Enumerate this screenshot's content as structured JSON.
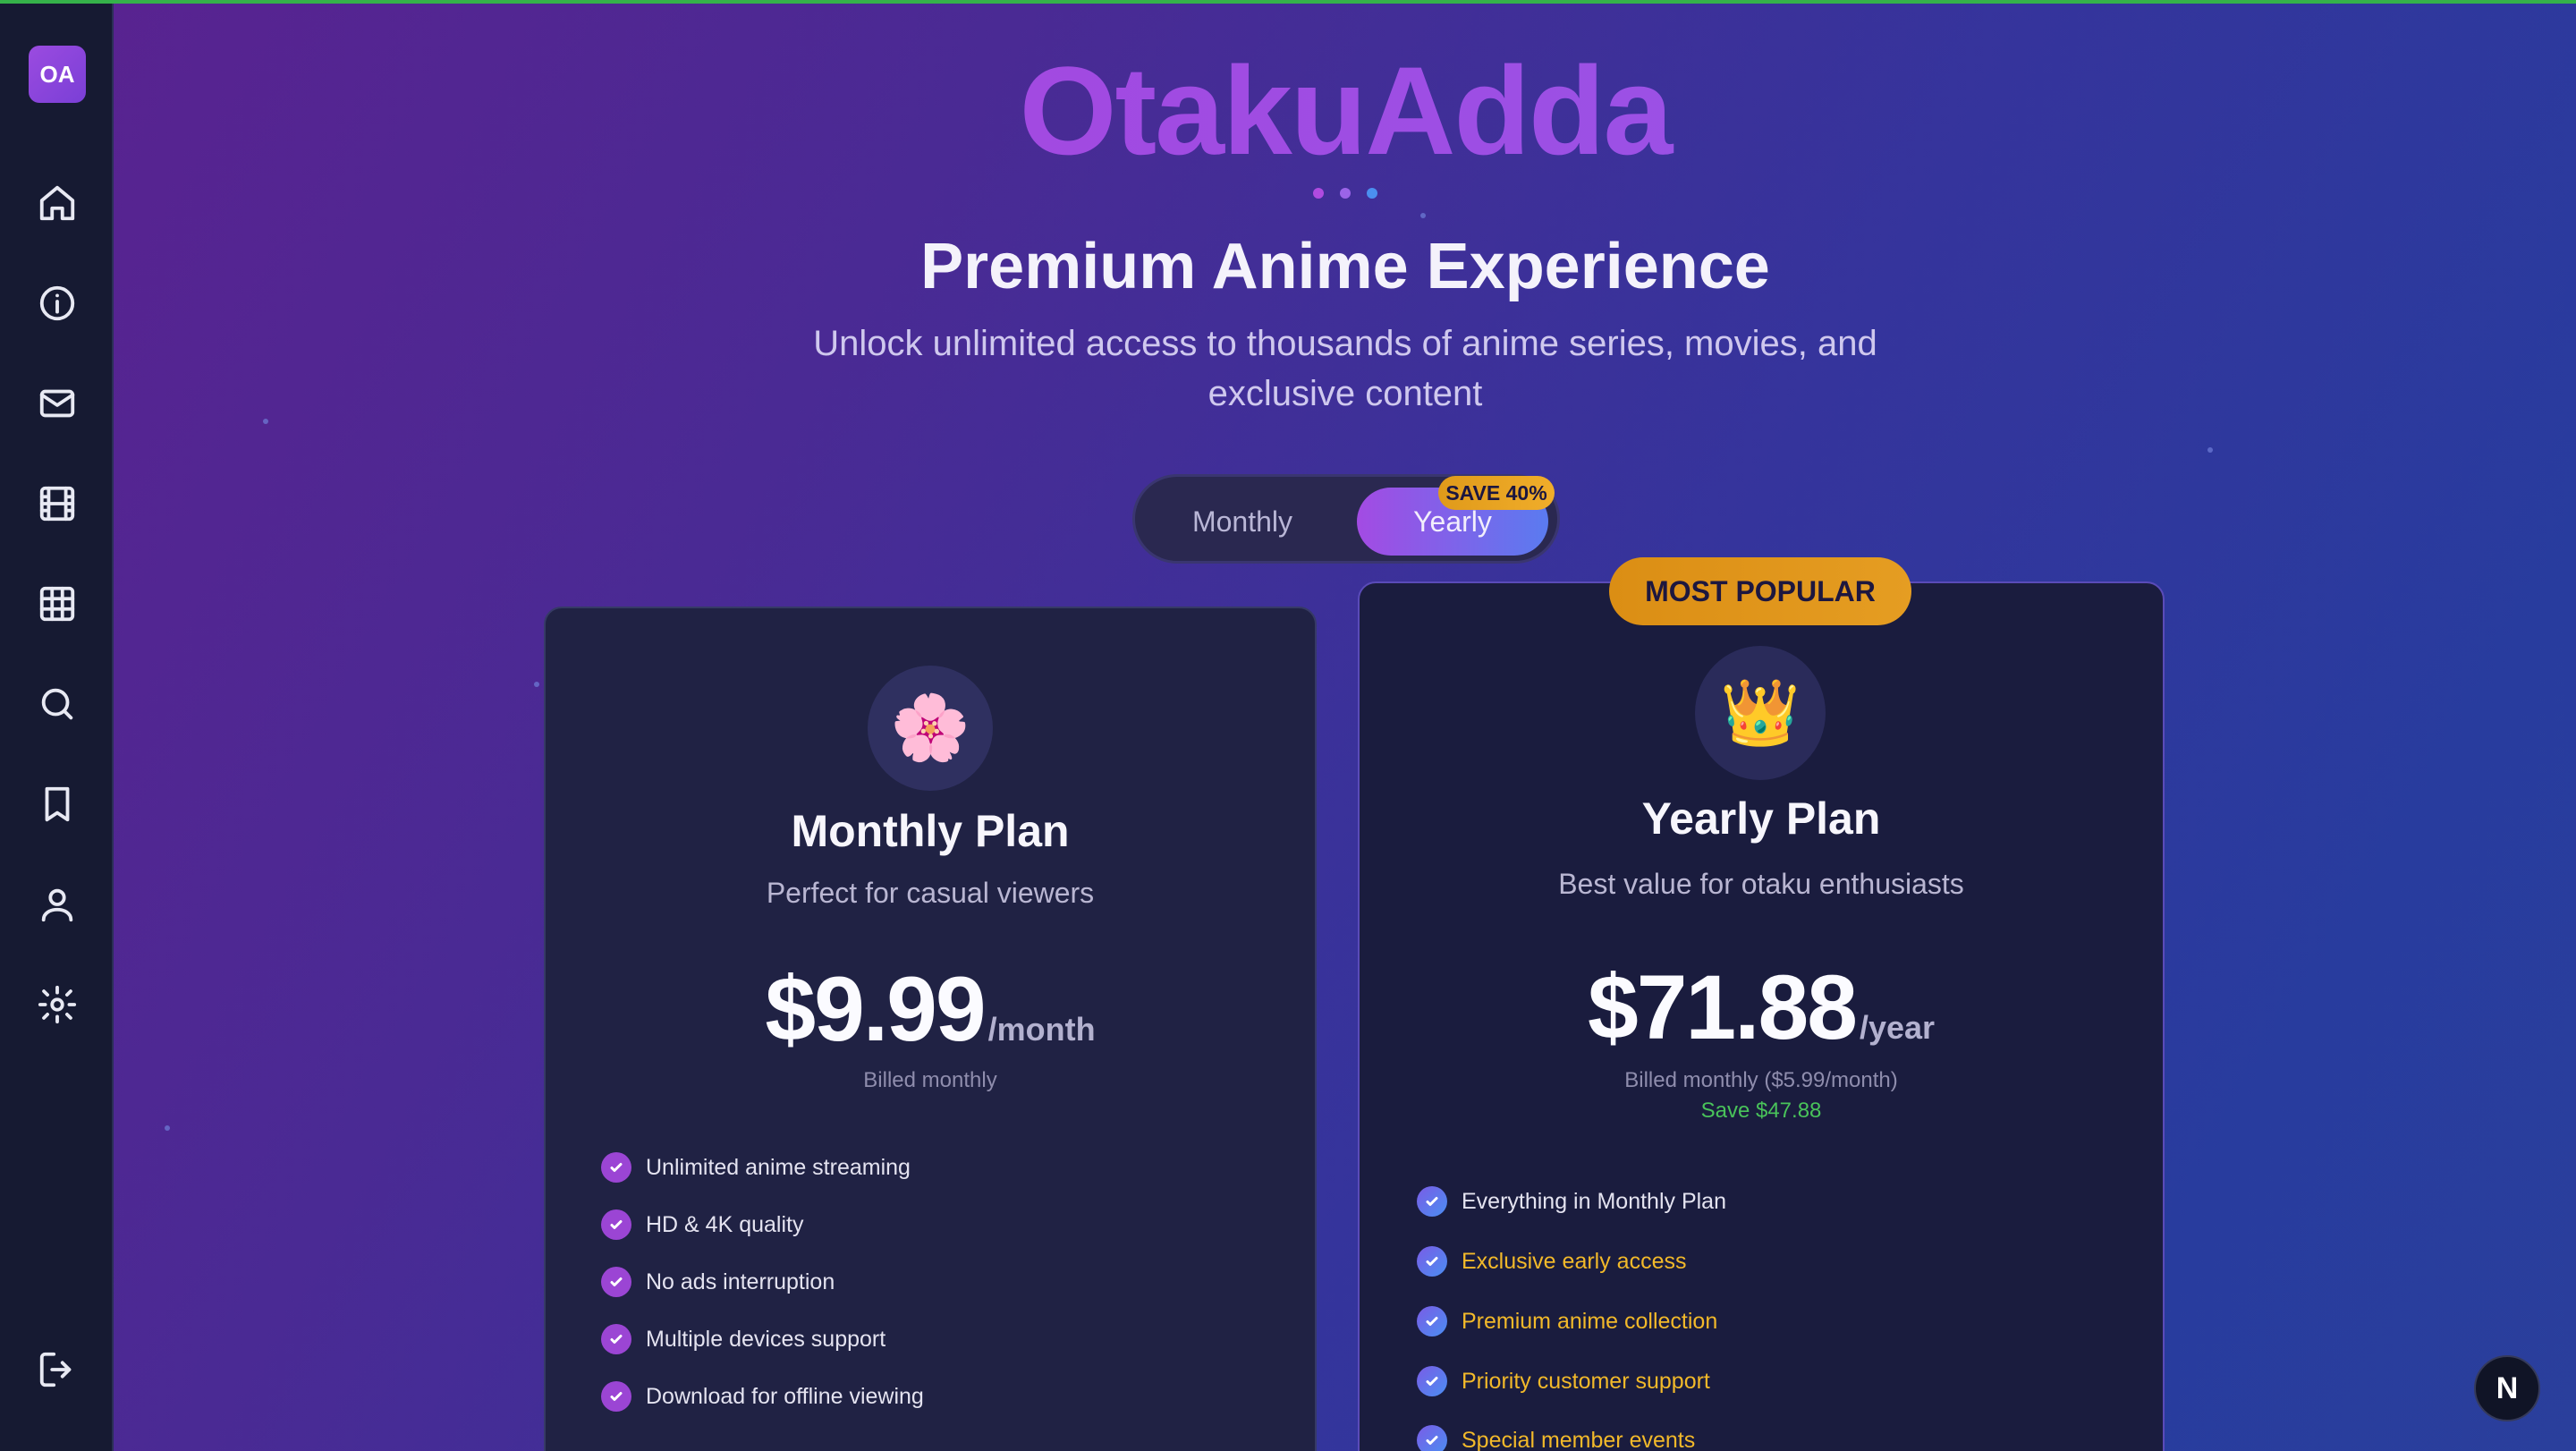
{
  "sidebar": {
    "logo_text": "OA",
    "items": [
      {
        "icon": "home-icon"
      },
      {
        "icon": "info-icon"
      },
      {
        "icon": "mail-icon"
      },
      {
        "icon": "film-icon"
      },
      {
        "icon": "grid-icon"
      },
      {
        "icon": "search-icon"
      },
      {
        "icon": "bookmark-icon"
      },
      {
        "icon": "user-icon"
      },
      {
        "icon": "gear-icon"
      }
    ],
    "logout_icon": "logout-icon"
  },
  "header": {
    "brand": "OtakuAdda",
    "headline": "Premium Anime Experience",
    "subline": "Unlock unlimited access to thousands of anime series, movies, and exclusive content",
    "dot_colors": [
      "#b04be0",
      "#9b64e8",
      "#4b8ff0"
    ]
  },
  "toggle": {
    "monthly_label": "Monthly",
    "yearly_label": "Yearly",
    "save_badge": "SAVE 40%",
    "selected": "Yearly"
  },
  "plans": {
    "monthly": {
      "icon": "🌸",
      "title": "Monthly Plan",
      "desc": "Perfect for casual viewers",
      "price": "$9.99",
      "period": "/month",
      "billed": "Billed monthly",
      "features": [
        {
          "text": "Unlimited anime streaming"
        },
        {
          "text": "HD & 4K quality"
        },
        {
          "text": "No ads interruption"
        },
        {
          "text": "Multiple devices support"
        },
        {
          "text": "Download for offline viewing"
        }
      ]
    },
    "yearly": {
      "badge": "MOST POPULAR",
      "icon": "👑",
      "title": "Yearly Plan",
      "desc": "Best value for otaku enthusiasts",
      "price": "$71.88",
      "period": "/year",
      "billed": "Billed monthly ($5.99/month)",
      "save": "Save $47.88",
      "features": [
        {
          "text": "Everything in Monthly Plan",
          "highlight": false
        },
        {
          "text": "Exclusive early access",
          "highlight": true
        },
        {
          "text": "Premium anime collection",
          "highlight": true
        },
        {
          "text": "Priority customer support",
          "highlight": true
        },
        {
          "text": "Special member events",
          "highlight": true
        }
      ]
    }
  },
  "floating_button": {
    "label": "N"
  },
  "colors": {
    "accent_purple": "#9b45d4",
    "accent_gold": "#e59d22",
    "highlight_text": "#f2b92a",
    "save_green": "#49c35a",
    "sidebar_bg": "#161a32"
  }
}
